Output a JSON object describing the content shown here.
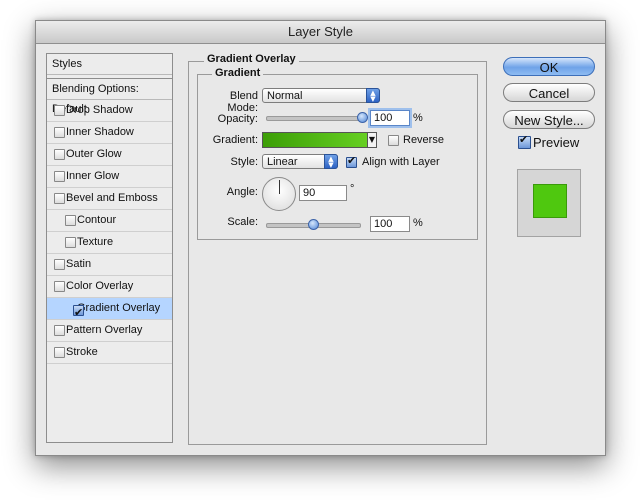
{
  "window": {
    "title": "Layer Style"
  },
  "styles_panel": {
    "header": "Styles",
    "blending_options": "Blending Options: Default",
    "items": [
      {
        "label": "Drop Shadow",
        "checked": false,
        "indent": false,
        "selected": false
      },
      {
        "label": "Inner Shadow",
        "checked": false,
        "indent": false,
        "selected": false
      },
      {
        "label": "Outer Glow",
        "checked": false,
        "indent": false,
        "selected": false
      },
      {
        "label": "Inner Glow",
        "checked": false,
        "indent": false,
        "selected": false
      },
      {
        "label": "Bevel and Emboss",
        "checked": false,
        "indent": false,
        "selected": false
      },
      {
        "label": "Contour",
        "checked": false,
        "indent": true,
        "selected": false
      },
      {
        "label": "Texture",
        "checked": false,
        "indent": true,
        "selected": false
      },
      {
        "label": "Satin",
        "checked": false,
        "indent": false,
        "selected": false
      },
      {
        "label": "Color Overlay",
        "checked": false,
        "indent": false,
        "selected": false
      },
      {
        "label": "Gradient Overlay",
        "checked": true,
        "indent": false,
        "selected": true
      },
      {
        "label": "Pattern Overlay",
        "checked": false,
        "indent": false,
        "selected": false
      },
      {
        "label": "Stroke",
        "checked": false,
        "indent": false,
        "selected": false
      }
    ]
  },
  "gradient_overlay": {
    "group_title": "Gradient Overlay",
    "subgroup_title": "Gradient",
    "blend_mode_label": "Blend Mode:",
    "blend_mode_value": "Normal",
    "opacity_label": "Opacity:",
    "opacity_value": "100",
    "opacity_unit": "%",
    "opacity_level": 1.0,
    "gradient_label": "Gradient:",
    "gradient_colors": [
      "#3c9e06",
      "#66cf22"
    ],
    "reverse_label": "Reverse",
    "reverse_checked": false,
    "style_label": "Style:",
    "style_value": "Linear",
    "align_label": "Align with Layer",
    "align_checked": true,
    "angle_label": "Angle:",
    "angle_value": "90",
    "angle_unit": "°",
    "scale_label": "Scale:",
    "scale_value": "100",
    "scale_unit": "%",
    "scale_level": 0.5
  },
  "buttons": {
    "ok": "OK",
    "cancel": "Cancel",
    "new_style": "New Style...",
    "preview_label": "Preview",
    "preview_checked": true
  },
  "preview": {
    "swatch_color": "#4fc80f"
  }
}
